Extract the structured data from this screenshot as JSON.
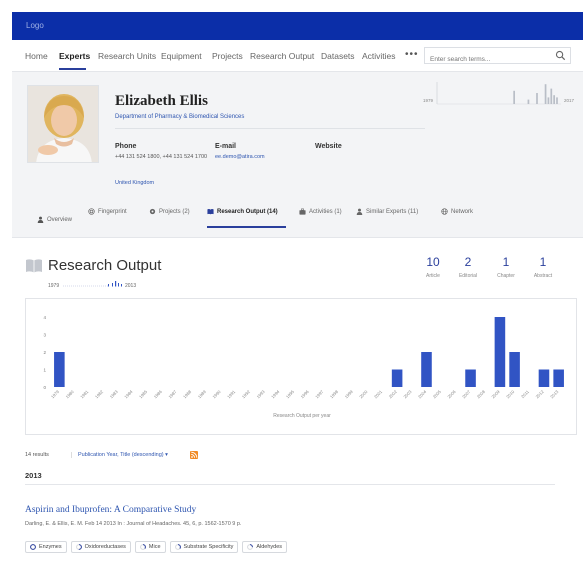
{
  "topbar": {
    "logo": "Logo"
  },
  "nav": {
    "items": [
      "Home",
      "Experts",
      "Research Units",
      "Equipment",
      "Projects",
      "Research Output",
      "Datasets",
      "Activities"
    ],
    "active_index": 1,
    "more": "•••",
    "search_placeholder": "Enter search terms..."
  },
  "profile": {
    "name": "Elizabeth Ellis",
    "department": "Department of Pharmacy & Biomedical Sciences",
    "phone_label": "Phone",
    "phone_value": "+44 131 524 1800, +44 131 524 1700",
    "email_label": "E-mail",
    "email_value": "ee.demo@atira.com",
    "website_label": "Website",
    "location": "United Kingdom",
    "mini_hist_start": "1979",
    "mini_hist_end": "2017",
    "mini_hist_bars": [
      0,
      0,
      0,
      0,
      0,
      0,
      0,
      0,
      0,
      0,
      0,
      0,
      0,
      0,
      0,
      0,
      0,
      0,
      0,
      0,
      0,
      0,
      0,
      0,
      0,
      0,
      0.6,
      0,
      0,
      0,
      0,
      0.2,
      0,
      0,
      0.5,
      0,
      0,
      0.9,
      0.3,
      0.7,
      0.4,
      0.3
    ]
  },
  "tabs": [
    {
      "label": "Overview",
      "icon": "user-icon"
    },
    {
      "label": "Fingerprint",
      "icon": "fingerprint-icon"
    },
    {
      "label": "Projects (2)",
      "icon": "gear-icon"
    },
    {
      "label": "Research Output (14)",
      "icon": "book-icon",
      "active": true
    },
    {
      "label": "Activities (1)",
      "icon": "briefcase-icon"
    },
    {
      "label": "Similar Experts (11)",
      "icon": "users-icon"
    },
    {
      "label": "Network",
      "icon": "globe-icon"
    }
  ],
  "research_output": {
    "title": "Research Output",
    "range_start": "1979",
    "range_end": "2013",
    "stats": [
      {
        "num": "10",
        "cap": "Article"
      },
      {
        "num": "2",
        "cap": "Editorial"
      },
      {
        "num": "1",
        "cap": "Chapter"
      },
      {
        "num": "1",
        "cap": "Abstract"
      }
    ]
  },
  "chart_data": {
    "type": "bar",
    "categories": [
      "1979",
      "1980",
      "1981",
      "1982",
      "1983",
      "1984",
      "1985",
      "1986",
      "1987",
      "1988",
      "1989",
      "1990",
      "1991",
      "1992",
      "1993",
      "1994",
      "1995",
      "1996",
      "1997",
      "1998",
      "1999",
      "2000",
      "2001",
      "2002",
      "2003",
      "2004",
      "2005",
      "2006",
      "2007",
      "2008",
      "2009",
      "2010",
      "2011",
      "2012",
      "2013"
    ],
    "values": [
      2,
      0,
      0,
      0,
      0,
      0,
      0,
      0,
      0,
      0,
      0,
      0,
      0,
      0,
      0,
      0,
      0,
      0,
      0,
      0,
      0,
      0,
      0,
      1,
      0,
      2,
      0,
      0,
      1,
      0,
      4,
      2,
      0,
      1,
      1
    ],
    "xlabel": "Research Output per year",
    "ylim": [
      0,
      4
    ],
    "yticks": [
      "0",
      "1",
      "2",
      "3",
      "4"
    ],
    "bar_color": "#3154c4",
    "grid": false
  },
  "results": {
    "count": "14 results",
    "sort": "Publication Year, Title (descending) ▾",
    "year": "2013"
  },
  "publication": {
    "title": "Aspirin and Ibuprofen: A Comparative Study",
    "meta": "Darling, E. & Ellis, E. M. Feb 14 2013 In : Journal of Headaches. 45, 6, p. 1562-1570 9 p.",
    "keywords": [
      {
        "label": "Enzymes",
        "level": 1.0
      },
      {
        "label": "Oxidoreductases",
        "level": 0.5
      },
      {
        "label": "Mice",
        "level": 0.35
      },
      {
        "label": "Substrate Specificity",
        "level": 0.35
      },
      {
        "label": "Aldehydes",
        "level": 0.25
      }
    ]
  }
}
